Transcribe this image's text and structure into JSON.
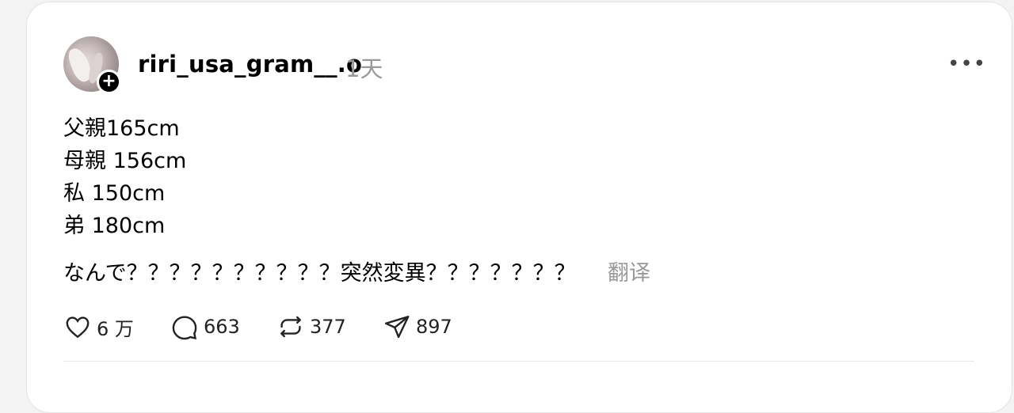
{
  "post": {
    "username": "riri_usa_gram__.o",
    "timestamp": "1天",
    "more_icon": "more-horizontal-icon",
    "follow_icon": "plus-icon",
    "lines": [
      "父親165cm",
      "母親 156cm",
      "私 150cm",
      "弟 180cm"
    ],
    "question": "なんで？？？？？？？？？？突然変異？？？？？？？",
    "translate_label": "翻译"
  },
  "actions": {
    "likes": "6 万",
    "comments": "663",
    "reposts": "377",
    "shares": "897"
  },
  "colors": {
    "muted_text": "#999999",
    "card_bg": "#ffffff",
    "page_bg": "#f3f3f3"
  }
}
